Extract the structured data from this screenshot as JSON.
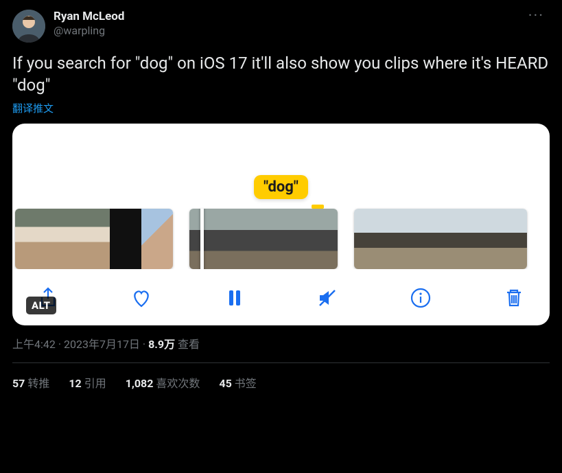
{
  "user": {
    "display_name": "Ryan McLeod",
    "handle": "@warpling"
  },
  "tweet": {
    "text": "If you search for \"dog\" on iOS 17 it'll also show you clips where it's HEARD \"dog\"",
    "translate_label": "翻译推文"
  },
  "media": {
    "caption_badge": "\"dog\"",
    "alt_badge": "ALT",
    "icons": {
      "share": "share-icon",
      "heart": "heart-icon",
      "pause": "pause-icon",
      "mute": "mute-icon",
      "info": "info-icon",
      "trash": "trash-icon"
    }
  },
  "meta": {
    "time": "上午4:42",
    "date": "2023年7月17日",
    "views_value": "8.9万",
    "views_label": "查看",
    "separator": " · "
  },
  "stats": {
    "retweets": {
      "value": "57",
      "label": "转推"
    },
    "quotes": {
      "value": "12",
      "label": "引用"
    },
    "likes": {
      "value": "1,082",
      "label": "喜欢次数"
    },
    "bookmarks": {
      "value": "45",
      "label": "书签"
    }
  }
}
